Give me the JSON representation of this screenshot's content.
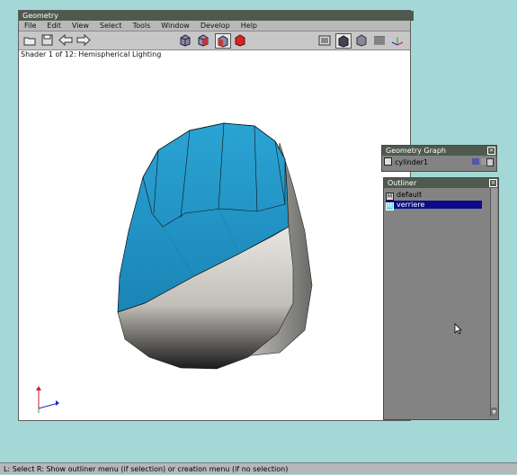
{
  "main_window": {
    "title": "Geometry",
    "menu": [
      "File",
      "Edit",
      "View",
      "Select",
      "Tools",
      "Window",
      "Develop",
      "Help"
    ],
    "shader_status": "Shader 1 of 12: Hemispherical Lighting"
  },
  "toolbar_icons": [
    "open-folder-icon",
    "save-disk-icon",
    "back-arrow-icon",
    "forward-arrow-icon",
    "cube-wire-icon",
    "cube-face-icon",
    "cube-edge-icon",
    "cube-red-icon",
    "grid-list-icon",
    "cube-solid-icon",
    "cube-shaded-icon",
    "checker-icon",
    "axes-icon"
  ],
  "geometry_graph": {
    "title": "Geometry Graph",
    "item": "cylinder1"
  },
  "outliner": {
    "title": "Outliner",
    "items": [
      "default",
      "verriere"
    ],
    "selected_index": 1
  },
  "status_bar": "L: Select   R: Show outliner menu (if selection) or creation menu (if no selection)",
  "colors": {
    "blue_face": "#2f9cc6",
    "titlebar": "#4f5a4f",
    "selection": "#0b0b8c",
    "background": "#a4d8d6"
  }
}
